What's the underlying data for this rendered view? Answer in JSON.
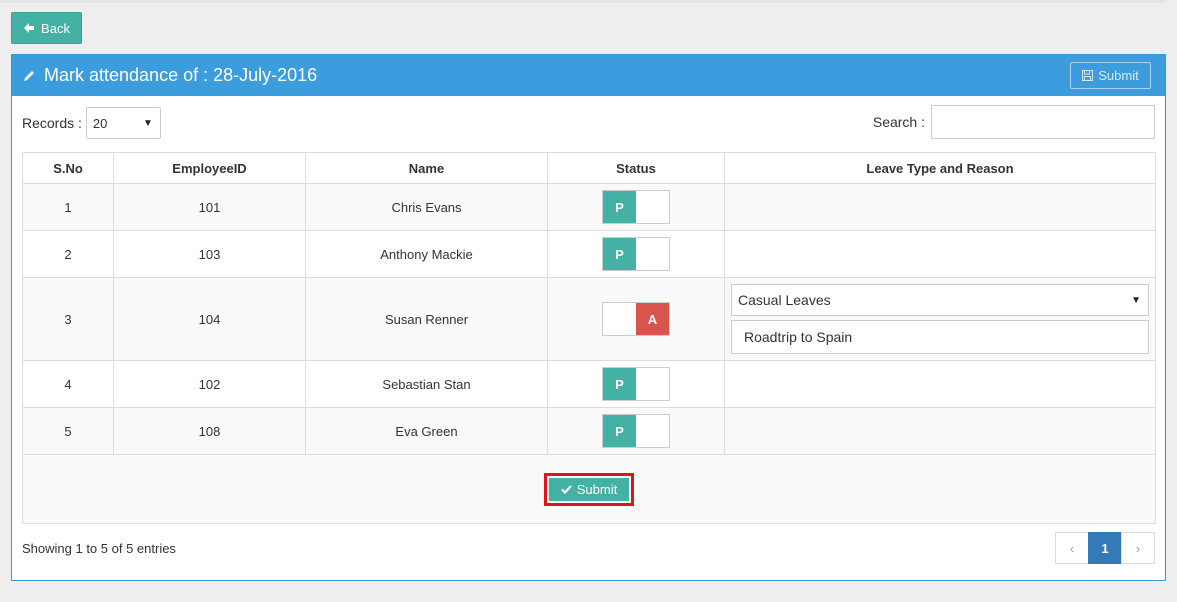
{
  "back_label": "Back",
  "panel": {
    "title": "Mark attendance of : 28-July-2016",
    "head_submit_label": "Submit"
  },
  "records": {
    "label": "Records :",
    "value": "20"
  },
  "search": {
    "label": "Search :",
    "value": ""
  },
  "table": {
    "headers": [
      "S.No",
      "EmployeeID",
      "Name",
      "Status",
      "Leave Type and Reason"
    ],
    "rows": [
      {
        "sno": "1",
        "id": "101",
        "name": "Chris Evans",
        "status": "P"
      },
      {
        "sno": "2",
        "id": "103",
        "name": "Anthony Mackie",
        "status": "P"
      },
      {
        "sno": "3",
        "id": "104",
        "name": "Susan Renner",
        "status": "A",
        "leave_type": "Casual Leaves",
        "reason": "Roadtrip to Spain"
      },
      {
        "sno": "4",
        "id": "102",
        "name": "Sebastian Stan",
        "status": "P"
      },
      {
        "sno": "5",
        "id": "108",
        "name": "Eva Green",
        "status": "P"
      }
    ]
  },
  "submit_label": "Submit",
  "showing_text": "Showing 1 to 5 of 5 entries",
  "pagination": {
    "prev": "‹",
    "current": "1",
    "next": "›"
  },
  "colors": {
    "accent": "#43b2a5",
    "header": "#3b9ddd",
    "absent": "#d9534f",
    "highlight": "#e0141b",
    "page_active": "#337ab7"
  }
}
